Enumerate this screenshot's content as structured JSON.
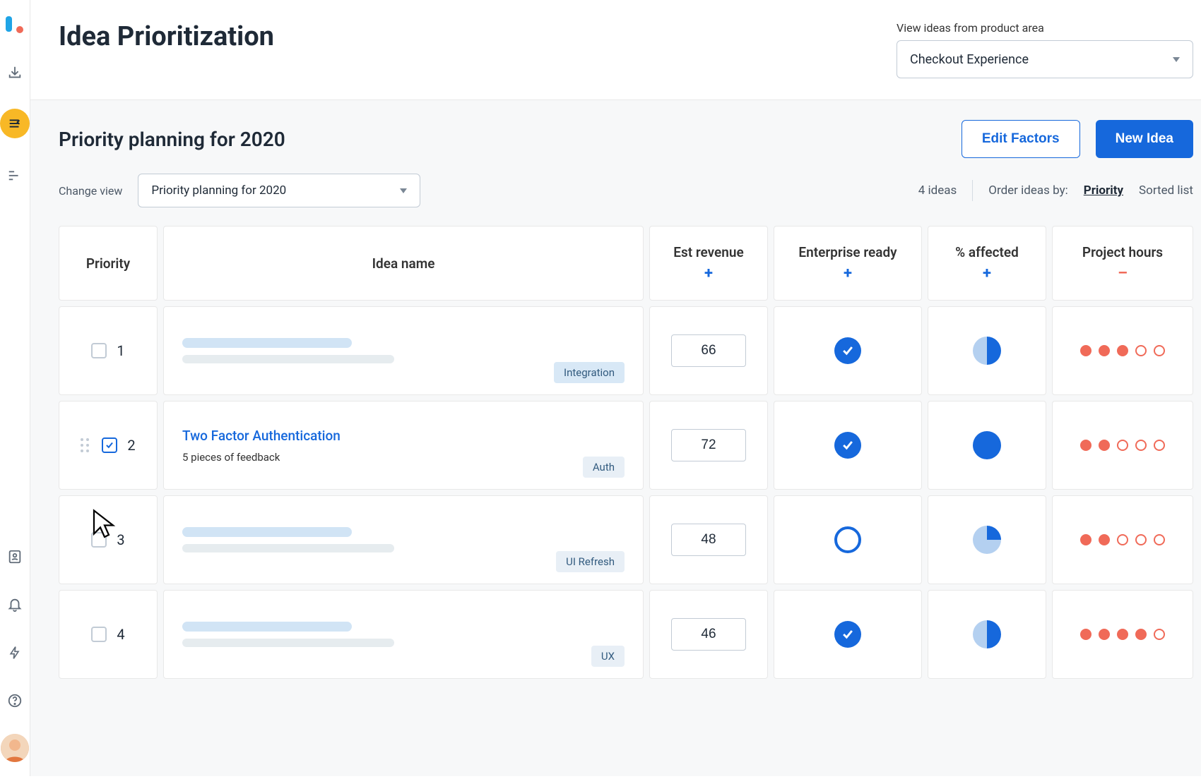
{
  "header": {
    "title": "Idea Prioritization",
    "area_label": "View ideas from product area",
    "area_selected": "Checkout Experience"
  },
  "subhead": {
    "title": "Priority planning for 2020",
    "edit_factors": "Edit Factors",
    "new_idea": "New Idea"
  },
  "viewbar": {
    "change_view_label": "Change view",
    "view_selected": "Priority planning for 2020",
    "count_text": "4 ideas",
    "order_label": "Order ideas by:",
    "order_priority": "Priority",
    "order_sorted": "Sorted list"
  },
  "columns": {
    "priority": "Priority",
    "idea": "Idea name",
    "revenue": "Est revenue",
    "enterprise": "Enterprise ready",
    "affected": "% affected",
    "hours": "Project hours"
  },
  "rows": [
    {
      "num": "1",
      "checked": false,
      "skeleton": true,
      "tag": "Integration",
      "revenue": "66",
      "enterprise": "filled",
      "affected": "half",
      "hours_filled": 3,
      "hours_total": 5
    },
    {
      "num": "2",
      "checked": true,
      "skeleton": false,
      "title": "Two Factor Authentication",
      "subtitle": "5 pieces of feedback",
      "tag": "Auth",
      "revenue": "72",
      "enterprise": "filled",
      "affected": "full",
      "hours_filled": 2,
      "hours_total": 5
    },
    {
      "num": "3",
      "checked": false,
      "skeleton": true,
      "tag": "UI Refresh",
      "revenue": "48",
      "enterprise": "outline",
      "affected": "quarter",
      "hours_filled": 2,
      "hours_total": 5
    },
    {
      "num": "4",
      "checked": false,
      "skeleton": true,
      "tag": "UX",
      "revenue": "46",
      "enterprise": "filled",
      "affected": "half",
      "hours_filled": 4,
      "hours_total": 5
    }
  ]
}
